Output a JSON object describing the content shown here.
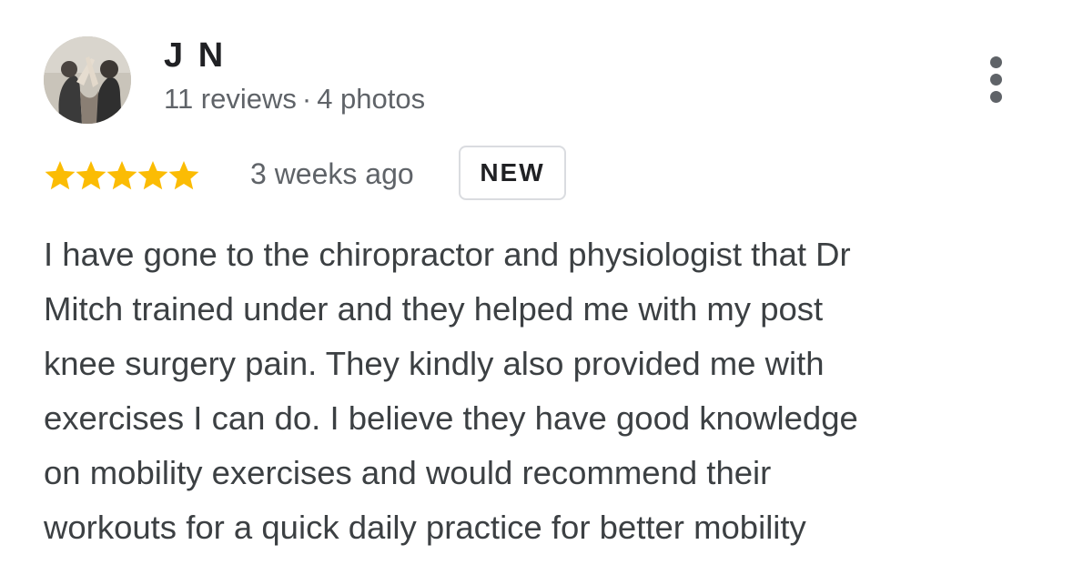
{
  "reviewer": {
    "name": "J N",
    "reviews": "11 reviews",
    "separator": "·",
    "photos": "4 photos",
    "avatar_icon": "profile-photo"
  },
  "more_menu": {
    "icon": "more-vert-icon"
  },
  "rating": {
    "stars": 5,
    "max_stars": 5,
    "star_color": "#fbbc04",
    "date": "3 weeks ago",
    "badge": "NEW"
  },
  "review": {
    "lines": [
      "I have gone to the chiropractor and physiologist that Dr",
      "Mitch trained under and they helped me with my post",
      "knee surgery pain. They kindly also provided me with",
      "exercises I can do. I believe they have good knowledge",
      "on mobility exercises and would recommend their",
      "workouts for a quick daily practice for better mobility"
    ]
  },
  "colors": {
    "name": "#202124",
    "meta": "#5f6368",
    "body_text": "#3c4043",
    "badge_border": "#dadce0"
  }
}
